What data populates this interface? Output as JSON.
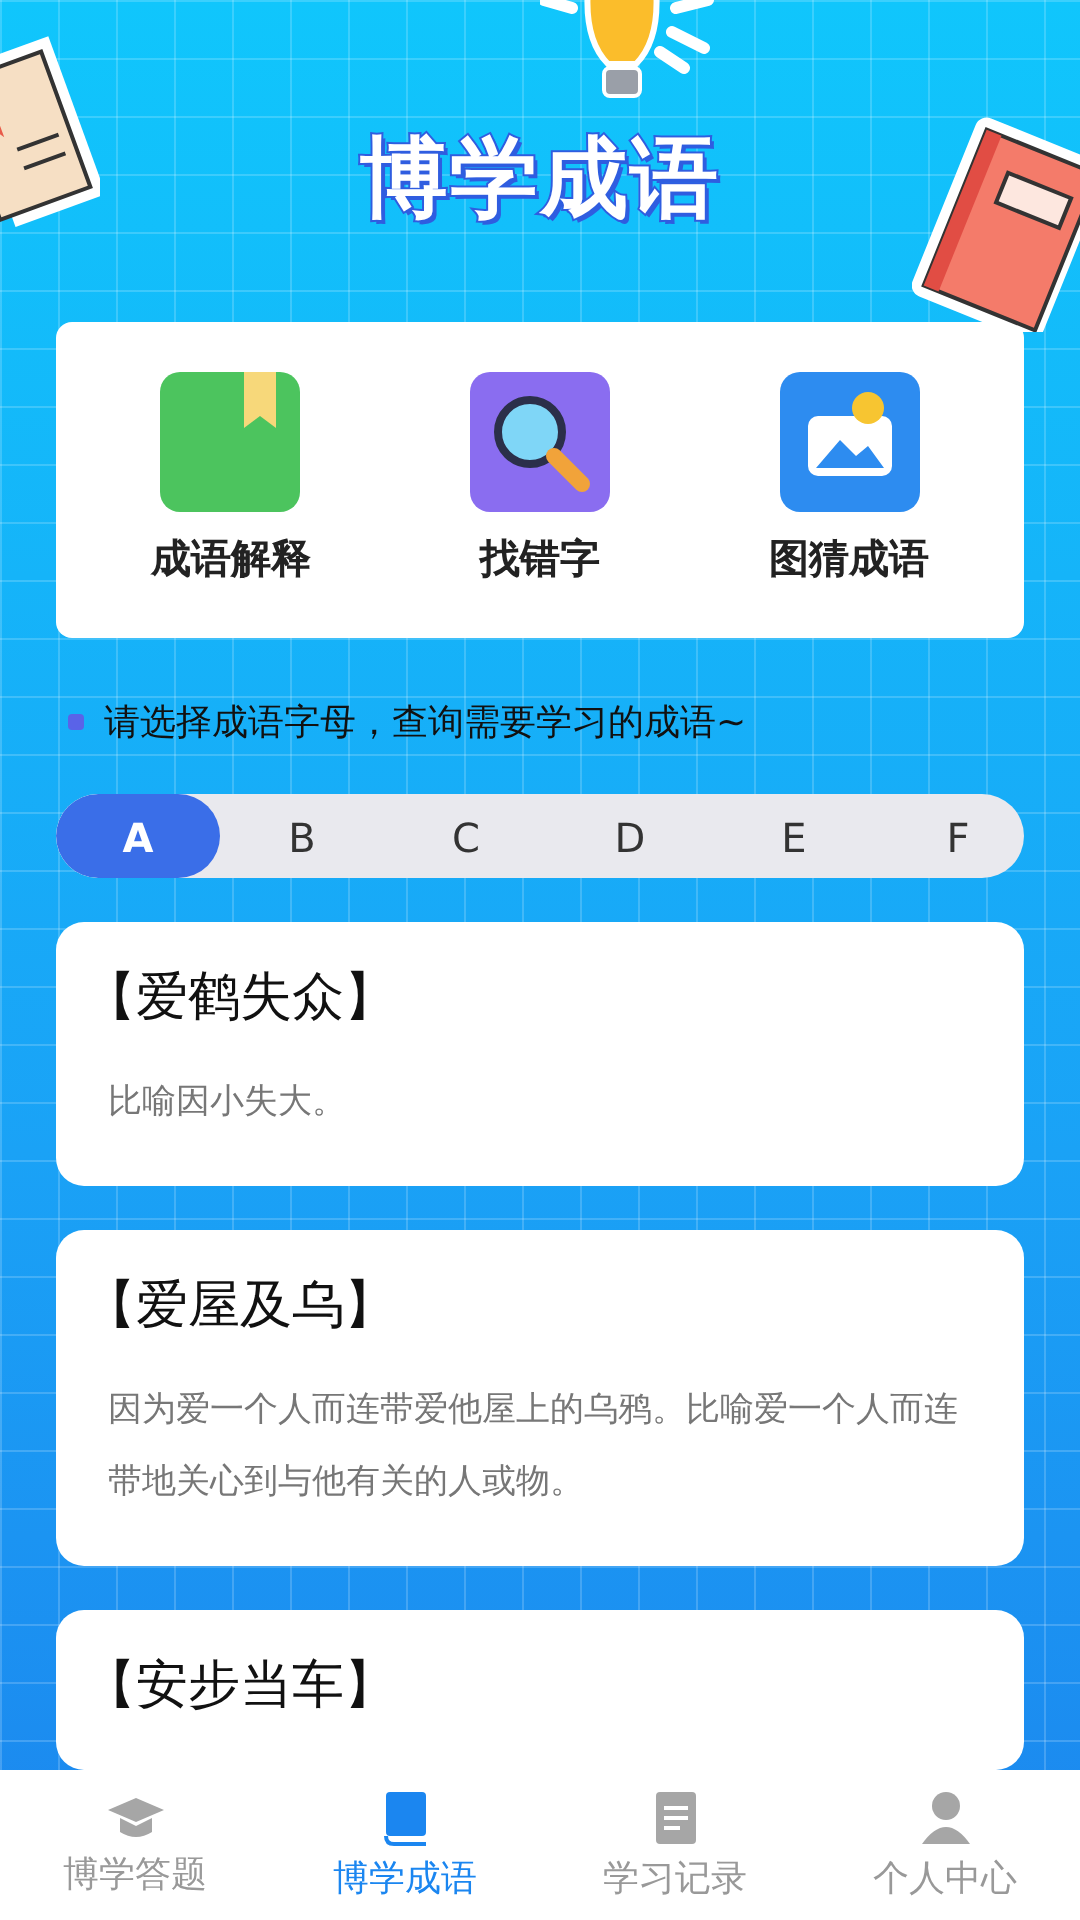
{
  "header": {
    "title": "博学成语"
  },
  "features": [
    {
      "label": "成语解释",
      "kind": "book"
    },
    {
      "label": "找错字",
      "kind": "search"
    },
    {
      "label": "图猜成语",
      "kind": "image"
    }
  ],
  "hint": "请选择成语字母，查询需要学习的成语~",
  "letters": [
    {
      "label": "A",
      "selected": true
    },
    {
      "label": "B",
      "selected": false
    },
    {
      "label": "C",
      "selected": false
    },
    {
      "label": "D",
      "selected": false
    },
    {
      "label": "E",
      "selected": false
    },
    {
      "label": "F",
      "selected": false
    }
  ],
  "idioms": [
    {
      "title": "【爱鹤失众】",
      "meaning": "比喻因小失大。"
    },
    {
      "title": "【爱屋及乌】",
      "meaning": "因为爱一个人而连带爱他屋上的乌鸦。比喻爱一个人而连带地关心到与他有关的人或物。"
    },
    {
      "title": "【安步当车】"
    }
  ],
  "tabs": [
    {
      "label": "博学答题",
      "kind": "cap",
      "selected": false
    },
    {
      "label": "博学成语",
      "kind": "book",
      "selected": true
    },
    {
      "label": "学习记录",
      "kind": "record",
      "selected": false
    },
    {
      "label": "个人中心",
      "kind": "person",
      "selected": false
    }
  ]
}
